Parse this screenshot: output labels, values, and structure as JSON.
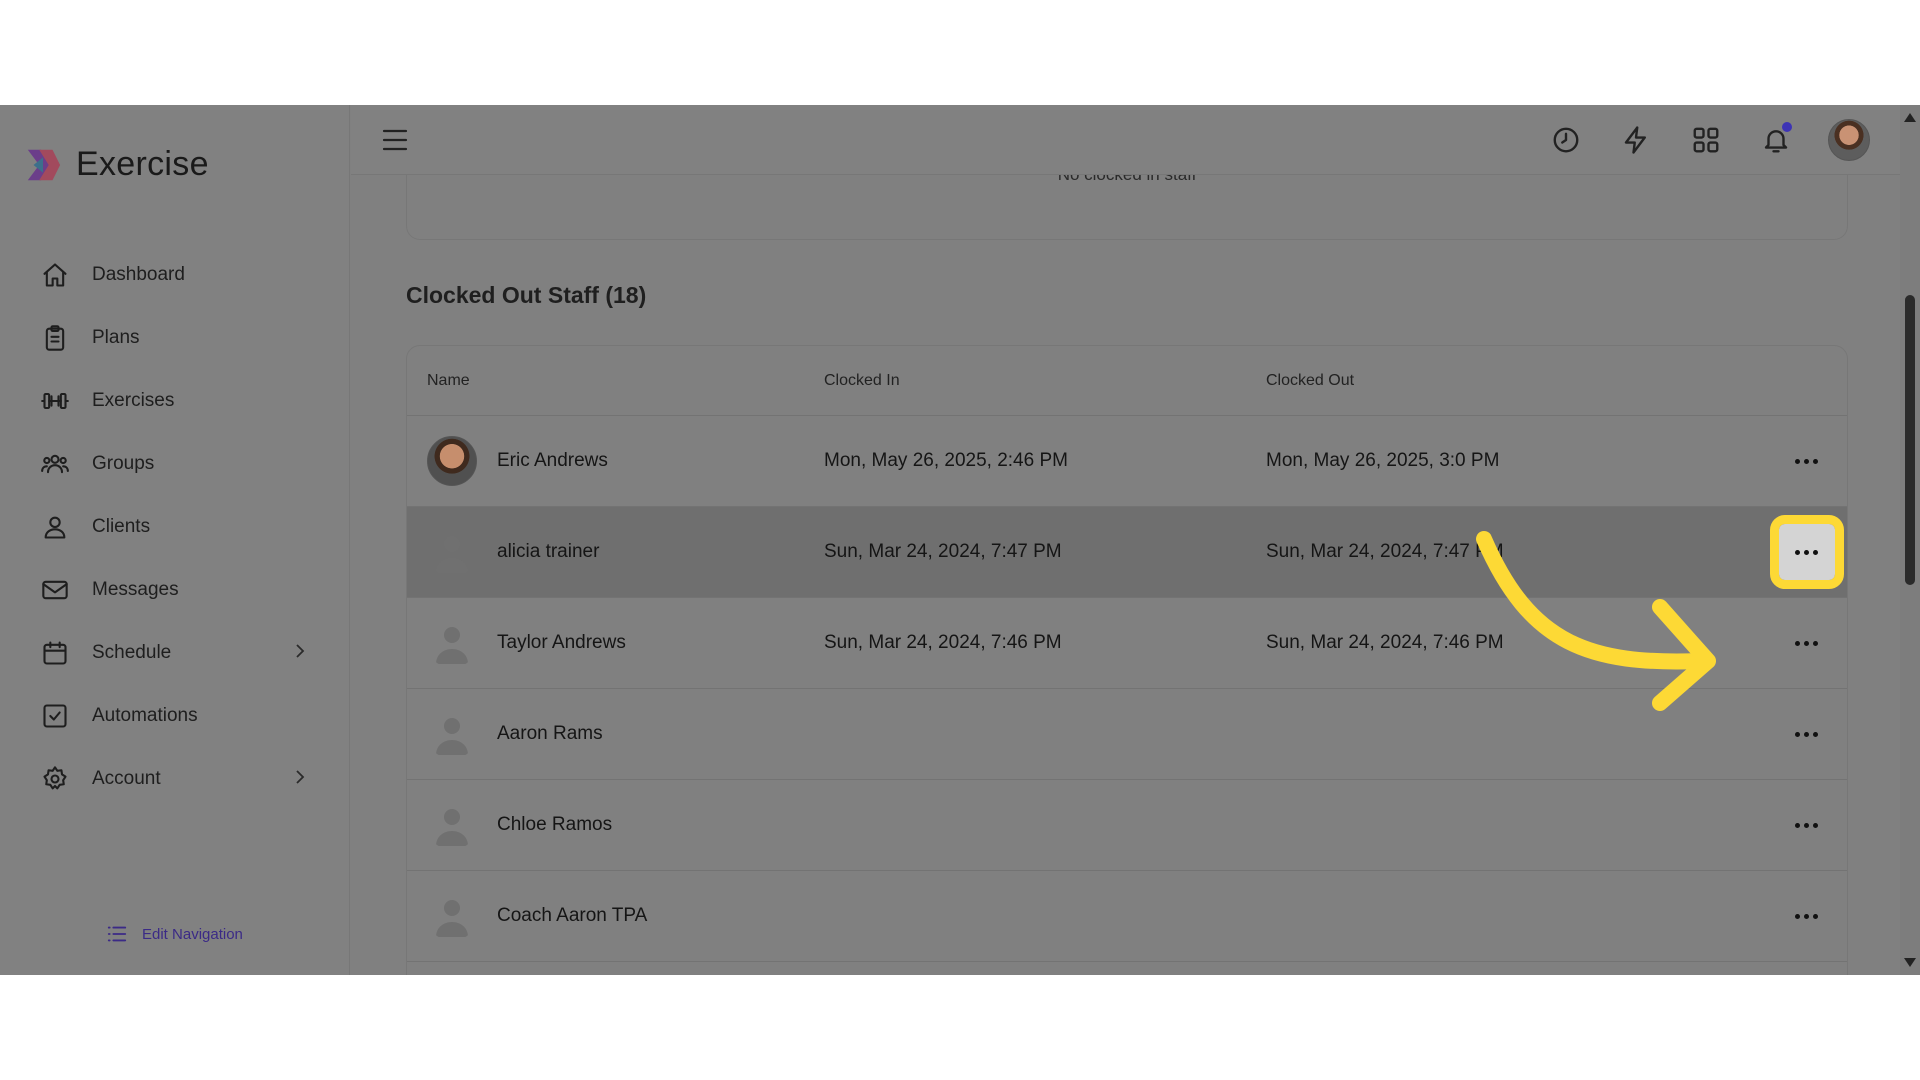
{
  "app": {
    "name": "Exercise"
  },
  "sidebar": {
    "items": [
      {
        "label": "Dashboard",
        "icon": "home-icon"
      },
      {
        "label": "Plans",
        "icon": "clipboard-icon"
      },
      {
        "label": "Exercises",
        "icon": "dumbbell-icon"
      },
      {
        "label": "Groups",
        "icon": "users-icon"
      },
      {
        "label": "Clients",
        "icon": "user-icon"
      },
      {
        "label": "Messages",
        "icon": "mail-icon"
      },
      {
        "label": "Schedule",
        "icon": "calendar-icon",
        "has_submenu": true
      },
      {
        "label": "Automations",
        "icon": "checkbox-icon"
      },
      {
        "label": "Account",
        "icon": "gear-icon",
        "has_submenu": true
      }
    ],
    "edit_navigation": "Edit Navigation"
  },
  "clocked_in": {
    "empty_message": "No clocked in staff"
  },
  "clocked_out": {
    "title": "Clocked Out Staff (18)",
    "columns": {
      "name": "Name",
      "clocked_in": "Clocked In",
      "clocked_out": "Clocked Out"
    },
    "rows": [
      {
        "name": "Eric Andrews",
        "clocked_in": "Mon, May 26, 2025, 2:46 PM",
        "clocked_out": "Mon, May 26, 2025, 3:0 PM",
        "avatar": "photo"
      },
      {
        "name": "alicia trainer",
        "clocked_in": "Sun, Mar 24, 2024, 7:47 PM",
        "clocked_out": "Sun, Mar 24, 2024, 7:47 PM",
        "avatar": "placeholder",
        "highlighted": true
      },
      {
        "name": "Taylor Andrews",
        "clocked_in": "Sun, Mar 24, 2024, 7:46 PM",
        "clocked_out": "Sun, Mar 24, 2024, 7:46 PM",
        "avatar": "placeholder"
      },
      {
        "name": "Aaron Rams",
        "clocked_in": "",
        "clocked_out": "",
        "avatar": "placeholder"
      },
      {
        "name": "Chloe Ramos",
        "clocked_in": "",
        "clocked_out": "",
        "avatar": "placeholder"
      },
      {
        "name": "Coach Aaron TPA",
        "clocked_in": "",
        "clocked_out": "",
        "avatar": "placeholder"
      }
    ]
  },
  "colors": {
    "highlight": "#fdd935",
    "accent": "#3d33b5"
  }
}
